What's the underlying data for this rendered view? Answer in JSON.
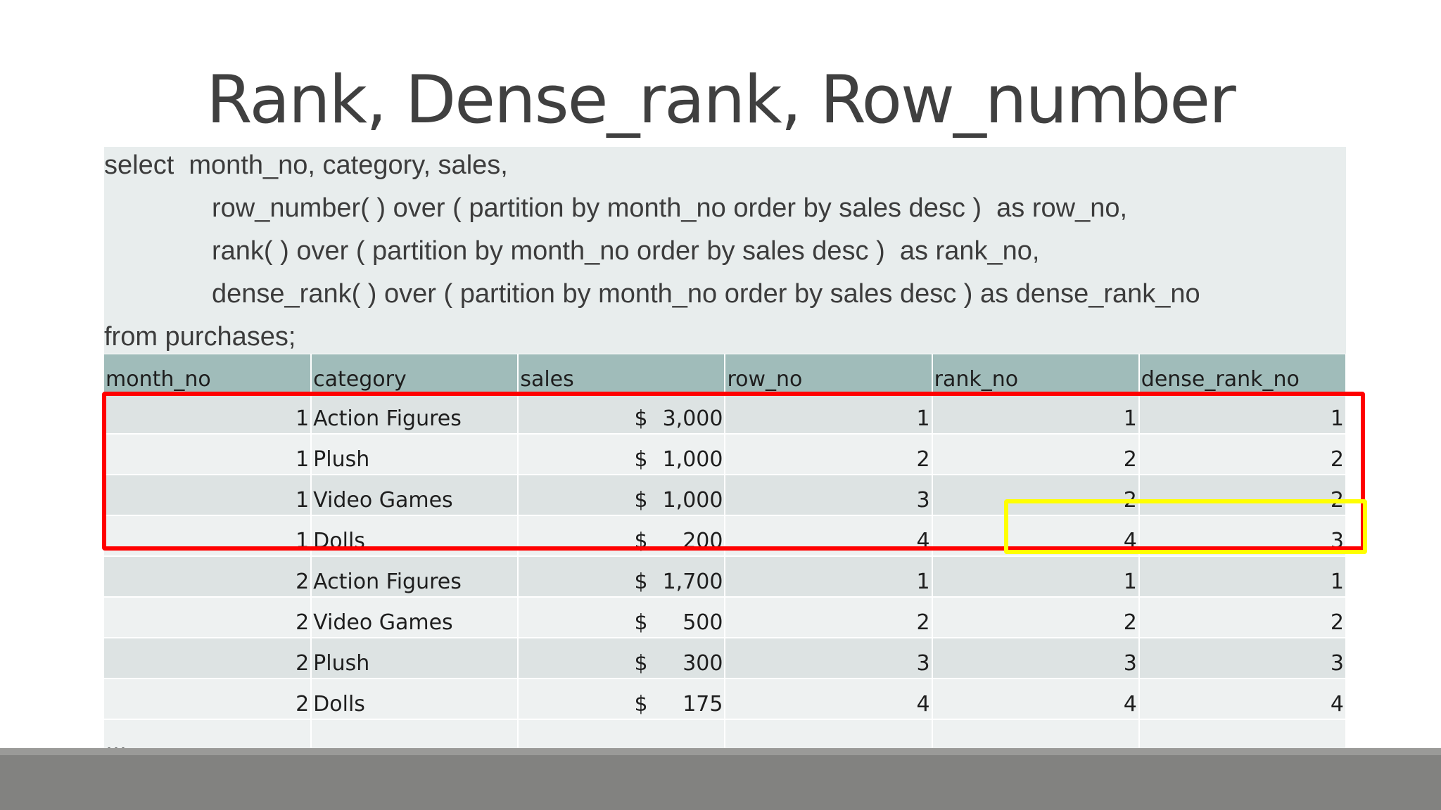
{
  "title": "Rank, Dense_rank, Row_number",
  "sql": {
    "lines": [
      "select  month_no, category, sales,",
      "row_number( ) over ( partition by month_no order by sales desc )  as row_no,",
      "rank( ) over ( partition by month_no order by sales desc )  as rank_no,",
      "dense_rank( ) over ( partition by month_no order by sales desc ) as dense_rank_no",
      "from purchases;"
    ]
  },
  "table": {
    "headers": [
      "month_no",
      "category",
      "sales",
      "row_no",
      "rank_no",
      "dense_rank_no"
    ],
    "rows": [
      {
        "month_no": "1",
        "category": "Action Figures",
        "currency": "$",
        "sales": "3,000",
        "row_no": "1",
        "rank_no": "1",
        "dense_rank_no": "1"
      },
      {
        "month_no": "1",
        "category": "Plush",
        "currency": "$",
        "sales": "1,000",
        "row_no": "2",
        "rank_no": "2",
        "dense_rank_no": "2"
      },
      {
        "month_no": "1",
        "category": "Video Games",
        "currency": "$",
        "sales": "1,000",
        "row_no": "3",
        "rank_no": "2",
        "dense_rank_no": "2"
      },
      {
        "month_no": "1",
        "category": "Dolls",
        "currency": "$",
        "sales": "200",
        "row_no": "4",
        "rank_no": "4",
        "dense_rank_no": "3"
      },
      {
        "month_no": "2",
        "category": "Action Figures",
        "currency": "$",
        "sales": "1,700",
        "row_no": "1",
        "rank_no": "1",
        "dense_rank_no": "1"
      },
      {
        "month_no": "2",
        "category": "Video Games",
        "currency": "$",
        "sales": "500",
        "row_no": "2",
        "rank_no": "2",
        "dense_rank_no": "2"
      },
      {
        "month_no": "2",
        "category": "Plush",
        "currency": "$",
        "sales": "300",
        "row_no": "3",
        "rank_no": "3",
        "dense_rank_no": "3"
      },
      {
        "month_no": "2",
        "category": "Dolls",
        "currency": "$",
        "sales": "175",
        "row_no": "4",
        "rank_no": "4",
        "dense_rank_no": "4"
      }
    ],
    "ellipsis": "…"
  },
  "highlights": {
    "red_color": "#ff0000",
    "yellow_color": "#ffff00"
  }
}
